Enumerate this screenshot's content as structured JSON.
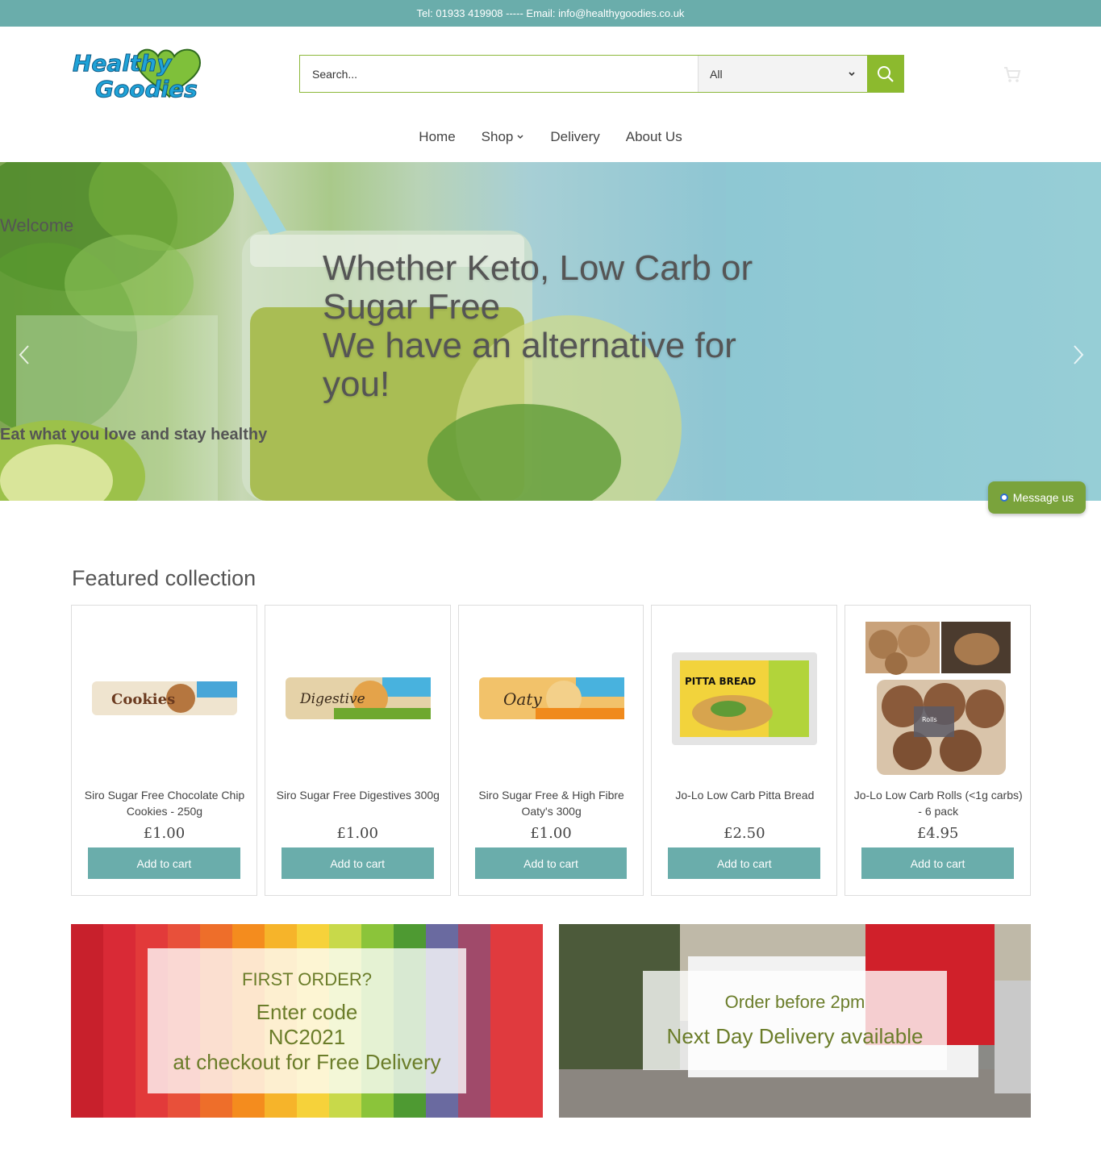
{
  "topbar": {
    "text": "Tel: 01933 419908 ----- Email: info@healthygoodies.co.uk"
  },
  "logo": {
    "line1": "Healthy",
    "line2": "Goodies"
  },
  "search": {
    "placeholder": "Search...",
    "category": "All"
  },
  "nav": [
    {
      "label": "Home"
    },
    {
      "label": "Shop"
    },
    {
      "label": "Delivery"
    },
    {
      "label": "About Us"
    }
  ],
  "hero": {
    "kicker": "Welcome",
    "title_line1": "Whether Keto, Low Carb or Sugar Free",
    "title_line2": "We have an alternative for you!",
    "subtitle": "Eat what you love and stay healthy"
  },
  "message_button": {
    "label": "Message us"
  },
  "featured": {
    "title": "Featured collection",
    "products": [
      {
        "title": "Siro Sugar Free Chocolate Chip Cookies - 250g",
        "price": "£1.00",
        "button": "Add to cart",
        "pack_text": "Cookies",
        "pack_color": "#6b3a1f"
      },
      {
        "title": "Siro Sugar Free Digestives 300g",
        "price": "£1.00",
        "button": "Add to cart",
        "pack_text": "Digestive",
        "pack_color": "#6ea82f"
      },
      {
        "title": "Siro Sugar Free & High Fibre Oaty's 300g",
        "price": "£1.00",
        "button": "Add to cart",
        "pack_text": "Oaty",
        "pack_color": "#f08a1c"
      },
      {
        "title": "Jo-Lo Low Carb Pitta Bread",
        "price": "£2.50",
        "button": "Add to cart",
        "pack_text": "PITTA BREAD",
        "pack_color": "#d7e53a"
      },
      {
        "title": "Jo-Lo Low Carb Rolls (<1g carbs) - 6 pack",
        "price": "£4.95",
        "button": "Add to cart",
        "pack_text": "Rolls",
        "pack_color": "#8a5a3a"
      }
    ]
  },
  "banners": {
    "left": {
      "line1": "FIRST ORDER?",
      "line2": "Enter code",
      "line3": "NC2021",
      "line4": "at checkout for Free Delivery"
    },
    "right": {
      "line1": "Order before 2pm",
      "line2": "Next Day Delivery available"
    }
  },
  "colors": {
    "teal": "#6aadab",
    "green": "#8cba2e",
    "banner_text": "#6b7d2a"
  }
}
